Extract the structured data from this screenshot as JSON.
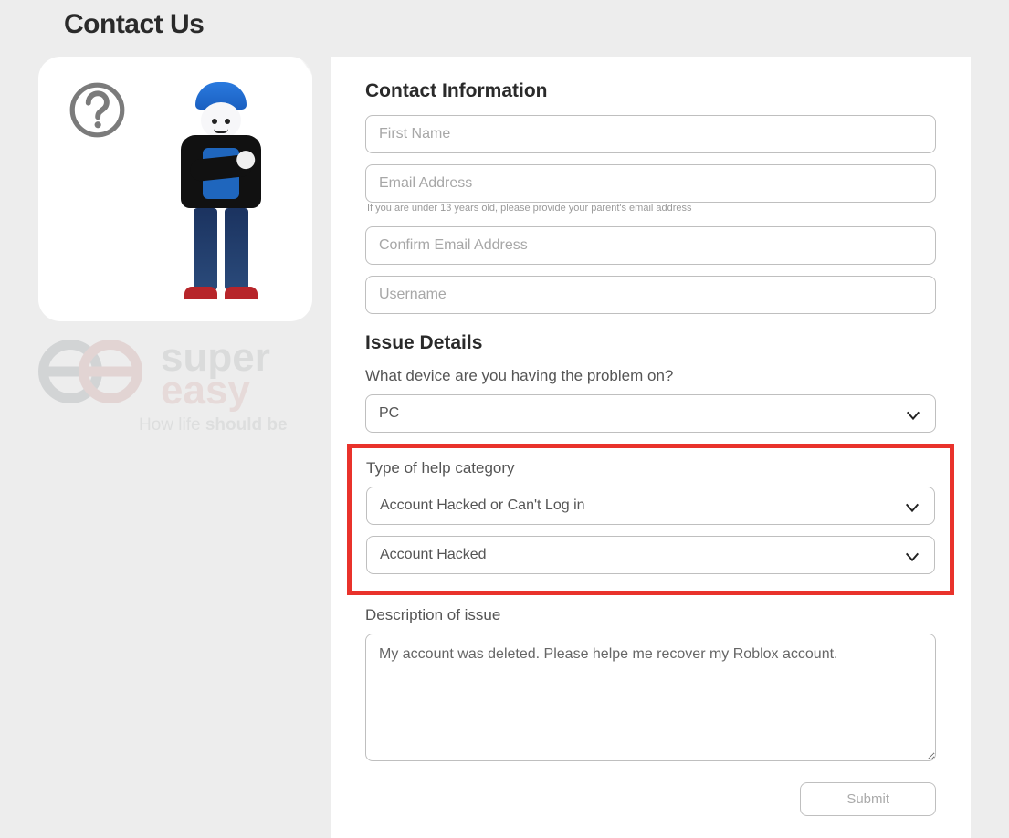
{
  "page_title": "Contact Us",
  "watermark": {
    "line1": "super",
    "line2": "easy",
    "tagline_pre": "How life ",
    "tagline_bold": "should be"
  },
  "contact": {
    "heading": "Contact Information",
    "first_name_placeholder": "First Name",
    "email_placeholder": "Email Address",
    "email_helper": "If you are under 13 years old, please provide your parent's email address",
    "confirm_email_placeholder": "Confirm Email Address",
    "username_placeholder": "Username"
  },
  "issue": {
    "heading": "Issue Details",
    "device_label": "What device are you having the problem on?",
    "device_value": "PC",
    "category_label": "Type of help category",
    "category_value": "Account Hacked or Can't Log in",
    "subcategory_value": "Account Hacked",
    "description_label": "Description of issue",
    "description_value": "My account was deleted. Please helpe me recover my Roblox account."
  },
  "submit_label": "Submit"
}
